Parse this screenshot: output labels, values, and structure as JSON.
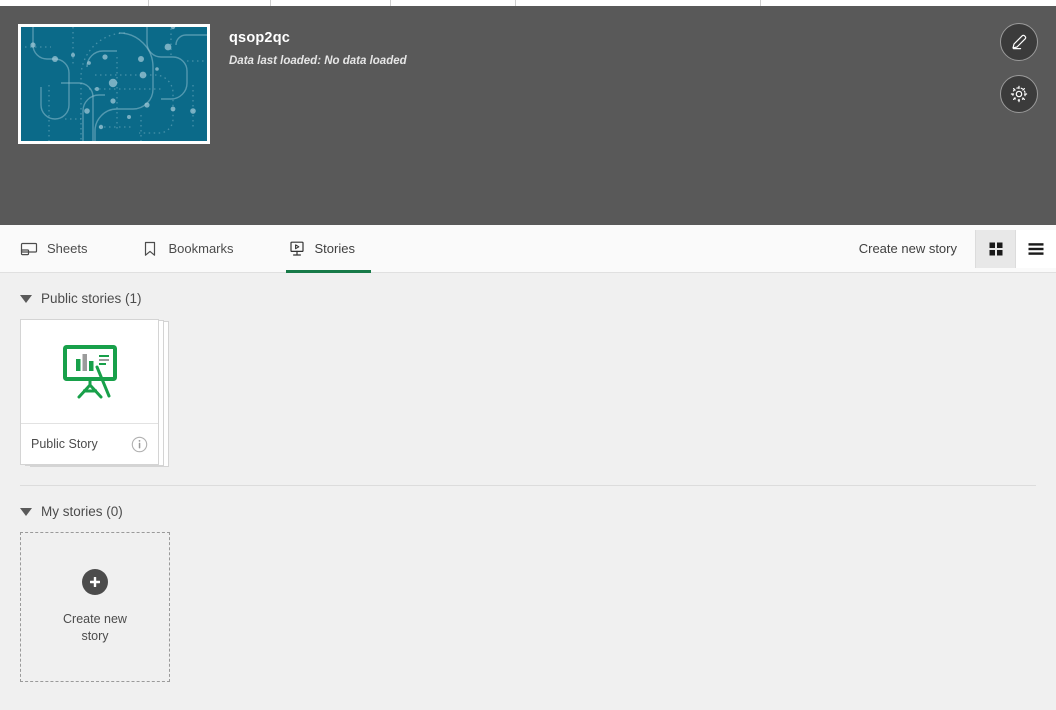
{
  "browser_strip": {
    "separators_x": [
      148,
      270,
      390,
      515,
      760
    ]
  },
  "header": {
    "app_title": "qsop2qc",
    "data_status": "Data last loaded: No data loaded",
    "thumbnail_name": "app-thumbnail",
    "thumbnail_color": "#0b6a89",
    "actions": [
      {
        "name": "edit-app-button",
        "icon": "pencil-icon"
      },
      {
        "name": "app-settings-button",
        "icon": "gear-icon"
      }
    ],
    "background_color": "#595959"
  },
  "tabbar": {
    "tabs": [
      {
        "label": "Sheets",
        "icon": "sheet-icon",
        "active": false
      },
      {
        "label": "Bookmarks",
        "icon": "bookmark-icon",
        "active": false
      },
      {
        "label": "Stories",
        "icon": "story-screen-icon",
        "active": true
      }
    ],
    "create_link": "Create new story",
    "views": [
      {
        "name": "grid-view-toggle",
        "icon": "grid-icon",
        "active": true
      },
      {
        "name": "list-view-toggle",
        "icon": "list-icon",
        "active": false
      }
    ],
    "active_color": "#177a48"
  },
  "content": {
    "sections": [
      {
        "title": "Public stories (1)",
        "expanded": true,
        "stories": [
          {
            "name": "Public Story",
            "icon": "easel-chart-icon",
            "info_icon": "info-icon"
          }
        ]
      },
      {
        "title": "My stories (0)",
        "expanded": true,
        "stories": [],
        "create_card": {
          "label_line1": "Create new",
          "label_line2": "story",
          "icon": "plus-circle-icon"
        }
      }
    ],
    "background_color": "#f0f0f0"
  }
}
